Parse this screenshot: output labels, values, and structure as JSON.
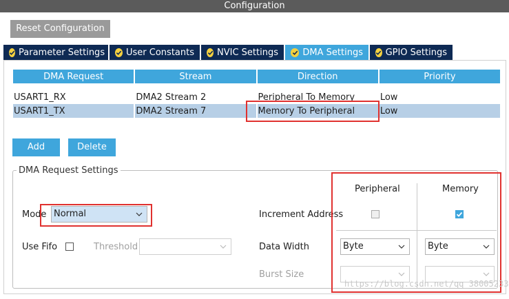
{
  "window": {
    "title": "Configuration"
  },
  "toolbar": {
    "reset_label": "Reset Configuration"
  },
  "tabs": [
    {
      "label": "Parameter Settings",
      "active": false
    },
    {
      "label": "User Constants",
      "active": false
    },
    {
      "label": "NVIC Settings",
      "active": false
    },
    {
      "label": "DMA Settings",
      "active": true
    },
    {
      "label": "GPIO Settings",
      "active": false
    }
  ],
  "dma_table": {
    "columns": [
      "DMA Request",
      "Stream",
      "Direction",
      "Priority"
    ],
    "rows": [
      {
        "request": "USART1_RX",
        "stream": "DMA2 Stream 2",
        "direction": "Peripheral To Memory",
        "priority": "Low",
        "selected": false
      },
      {
        "request": "USART1_TX",
        "stream": "DMA2 Stream 7",
        "direction": "Memory To Peripheral",
        "priority": "Low",
        "selected": true
      }
    ]
  },
  "actions": {
    "add_label": "Add",
    "delete_label": "Delete"
  },
  "settings": {
    "legend": "DMA Request Settings",
    "peripheral_header": "Peripheral",
    "memory_header": "Memory",
    "mode_label": "Mode",
    "mode_value": "Normal",
    "increment_label": "Increment Address",
    "peripheral_increment": false,
    "memory_increment": true,
    "use_fifo_label": "Use Fifo",
    "use_fifo": false,
    "threshold_label": "Threshold",
    "threshold_value": "",
    "data_width_label": "Data Width",
    "peripheral_data_width": "Byte",
    "memory_data_width": "Byte",
    "burst_size_label": "Burst Size",
    "peripheral_burst": "",
    "memory_burst": ""
  },
  "watermark": "https://blog.csdn.net/qq_38005233",
  "colors": {
    "title_bar": "#5b5b5b",
    "tab_inactive": "#0e2a54",
    "tab_active": "#3fa6dc",
    "accent": "#3fa6dc",
    "selected_row": "#b7cfe6",
    "annotation_red": "#e0312f"
  }
}
